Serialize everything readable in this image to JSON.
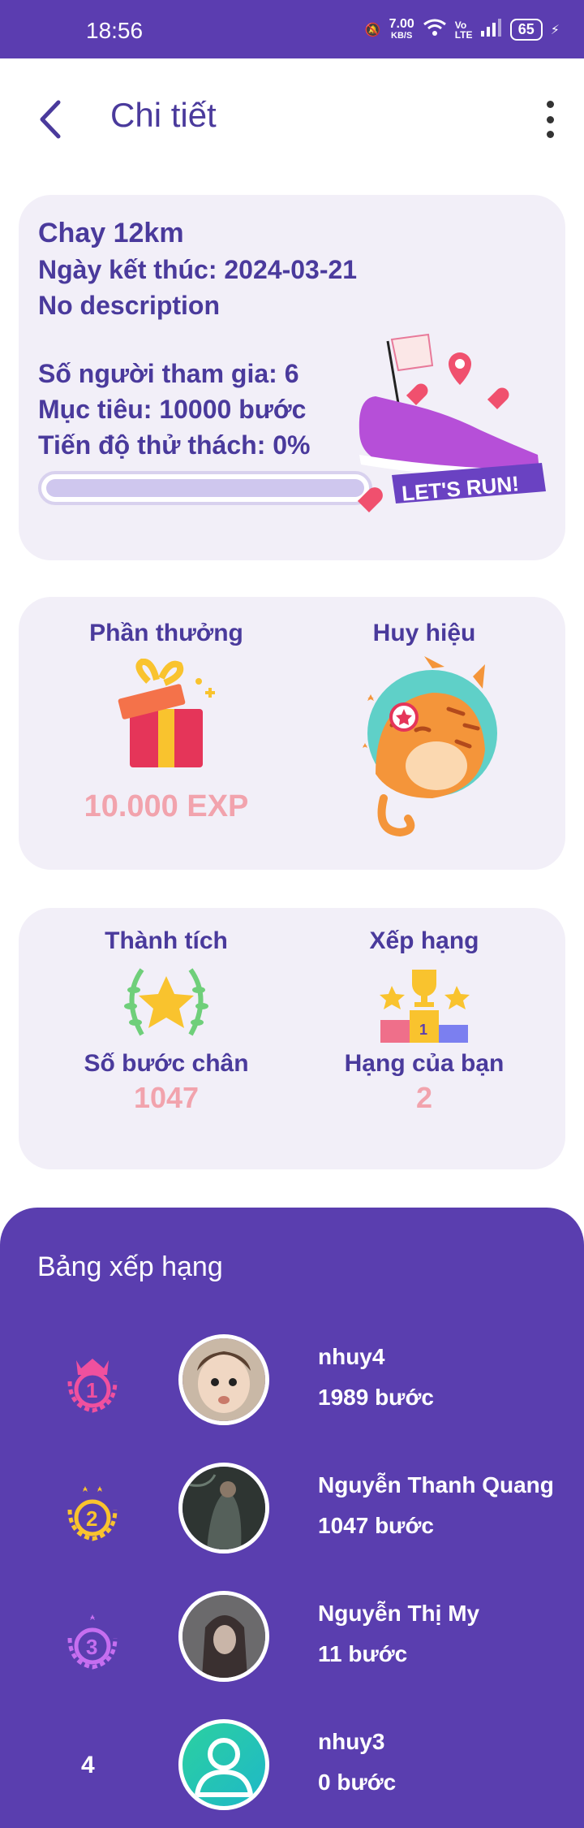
{
  "status_bar": {
    "time": "18:56",
    "speed": "7.00",
    "speed_unit": "KB/S",
    "network": "Vo LTE",
    "battery": "65"
  },
  "header": {
    "title": "Chi tiết"
  },
  "challenge": {
    "name": "Chay 12km",
    "end_date": "Ngày kết thúc: 2024-03-21",
    "description": "No description",
    "participants": "Số người tham gia: 6",
    "goal": "Mục tiêu: 10000 bước",
    "progress_text": "Tiến độ thử thách: 0%",
    "progress": 0,
    "sticker_text": "LET'S RUN!"
  },
  "rewards": {
    "reward_title": "Phần thưởng",
    "reward_value": "10.000 EXP",
    "badge_title": "Huy hiệu"
  },
  "stats": {
    "achievement_title": "Thành tích",
    "steps_label": "Số bước chân",
    "steps_value": "1047",
    "ranking_title": "Xếp hạng",
    "rank_label": "Hạng của bạn",
    "rank_value": "2"
  },
  "leaderboard": {
    "title": "Bảng xếp hạng",
    "entries": [
      {
        "rank": "1",
        "name": "nhuy4",
        "steps": "1989 bước"
      },
      {
        "rank": "2",
        "name": "Nguyễn Thanh Quang",
        "steps": "1047 bước"
      },
      {
        "rank": "3",
        "name": "Nguyễn Thị My",
        "steps": "11 bước"
      },
      {
        "rank": "4",
        "name": "nhuy3",
        "steps": "0 bước"
      }
    ]
  },
  "colors": {
    "primary": "#5b3db0",
    "card_bg": "#f2eff8",
    "accent_pink": "#f2a3ad"
  }
}
